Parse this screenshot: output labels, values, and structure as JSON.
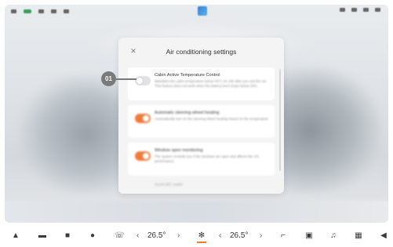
{
  "dialog": {
    "title": "Air conditioning settings",
    "close_icon": "close-icon",
    "items": [
      {
        "title": "Cabin Active Temperature Control",
        "description": "Maintains the cabin temperature below 45°C for 24h after you exit the car. This feature does not work when the battery level drops below 20%.",
        "enabled": false
      },
      {
        "title": "Automatic steering wheel heating",
        "description": "Automatically turn on the steering wheel heating based on the temperature",
        "enabled": true
      },
      {
        "title": "Window open monitoring",
        "description": "The system reminds you if the windows are open and affects the A/C performance",
        "enabled": true
      }
    ],
    "partial_row": "Scent A/C outlet"
  },
  "callout": {
    "label": "01"
  },
  "dock": {
    "left_temp": "26.5°",
    "right_temp": "26.5°",
    "icons": [
      "car-icon",
      "seat-icon",
      "vehicle-icon",
      "chat-icon",
      "phone-icon",
      "fan-icon",
      "wiper-icon",
      "media-icon",
      "music-icon",
      "apps-icon",
      "volume-icon"
    ]
  },
  "colors": {
    "toggle_on": "#f07a3a",
    "toggle_off": "#e2e2e4",
    "callout": "#7a7a7a"
  }
}
